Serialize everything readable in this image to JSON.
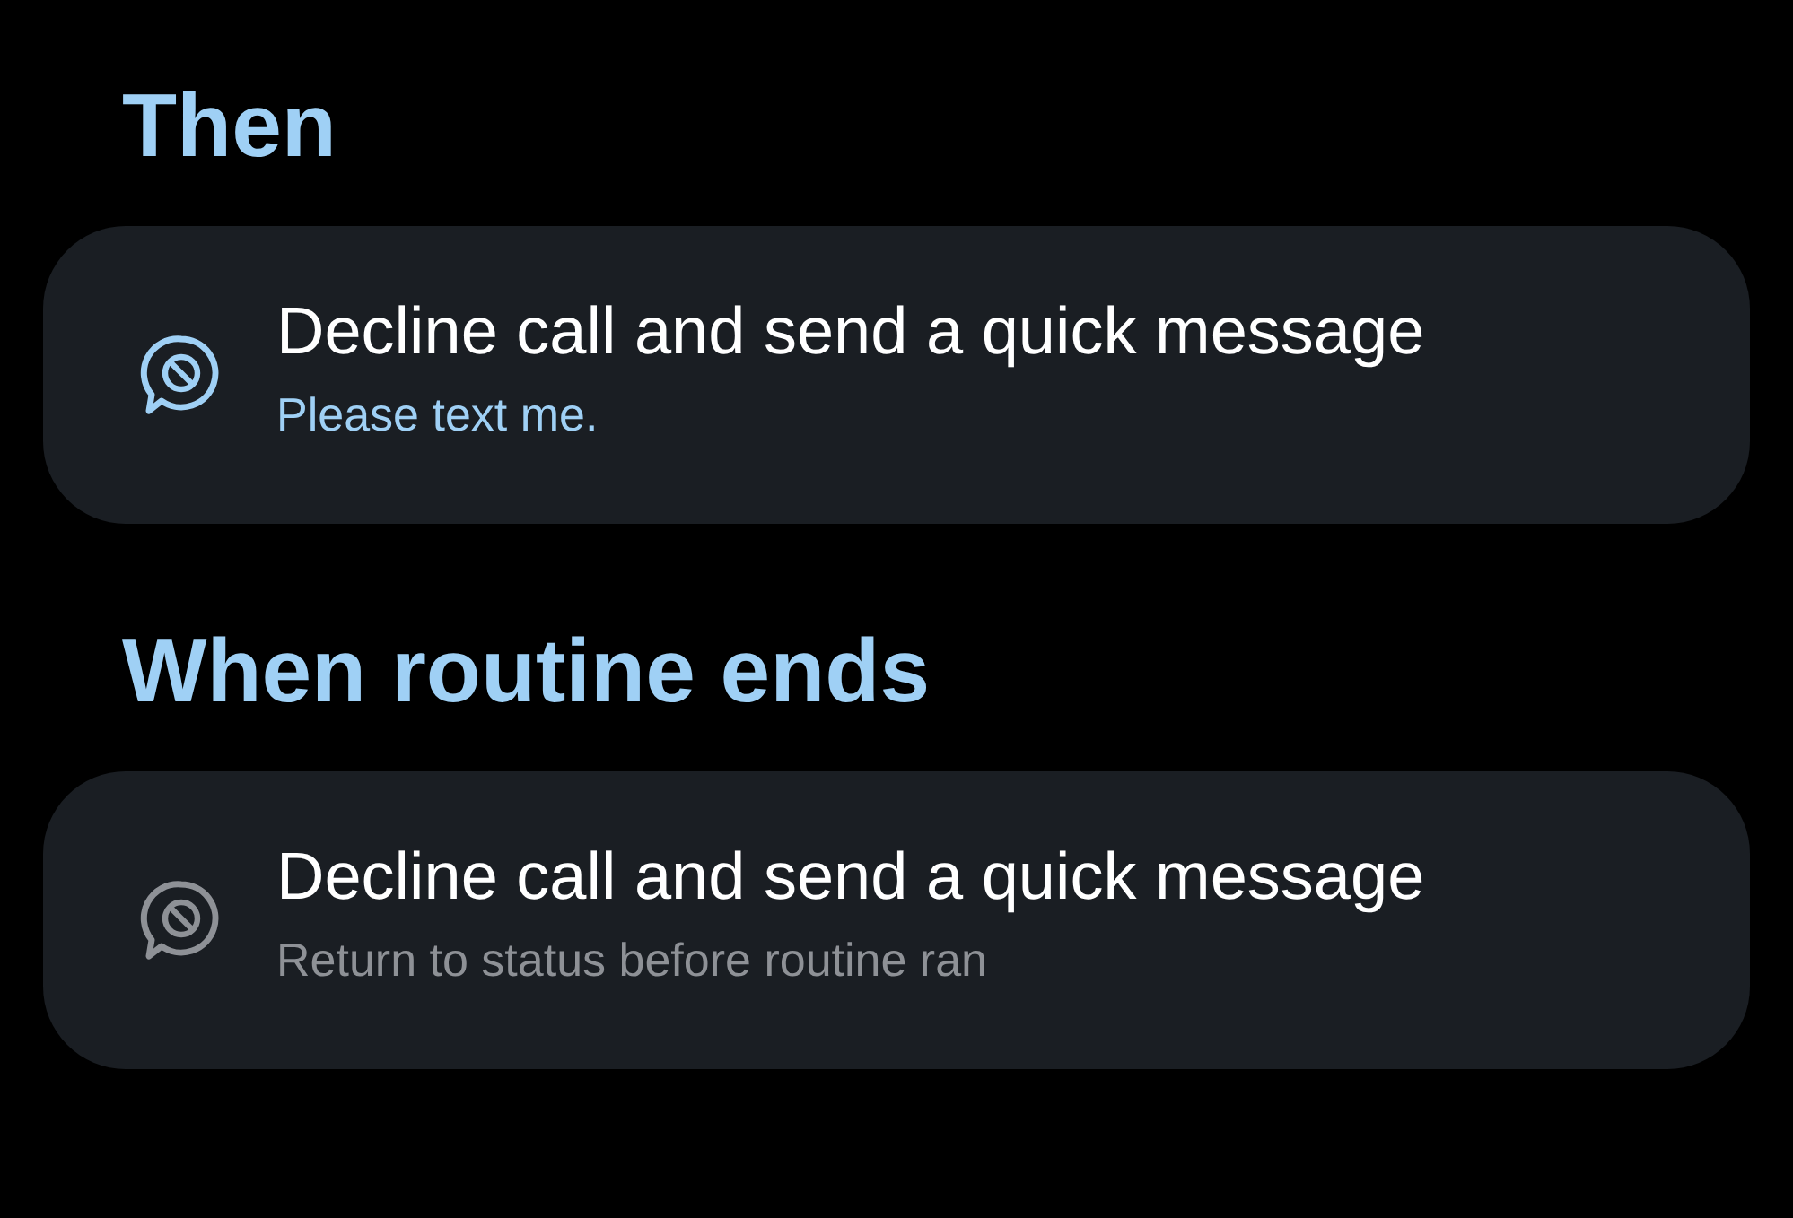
{
  "sections": [
    {
      "heading": "Then",
      "actions": [
        {
          "title": "Decline call and send a quick message",
          "subtitle": "Please text me.",
          "active": true
        }
      ]
    },
    {
      "heading": "When routine ends",
      "actions": [
        {
          "title": "Decline call and send a quick message",
          "subtitle": "Return to status before routine ran",
          "active": false
        }
      ]
    }
  ]
}
